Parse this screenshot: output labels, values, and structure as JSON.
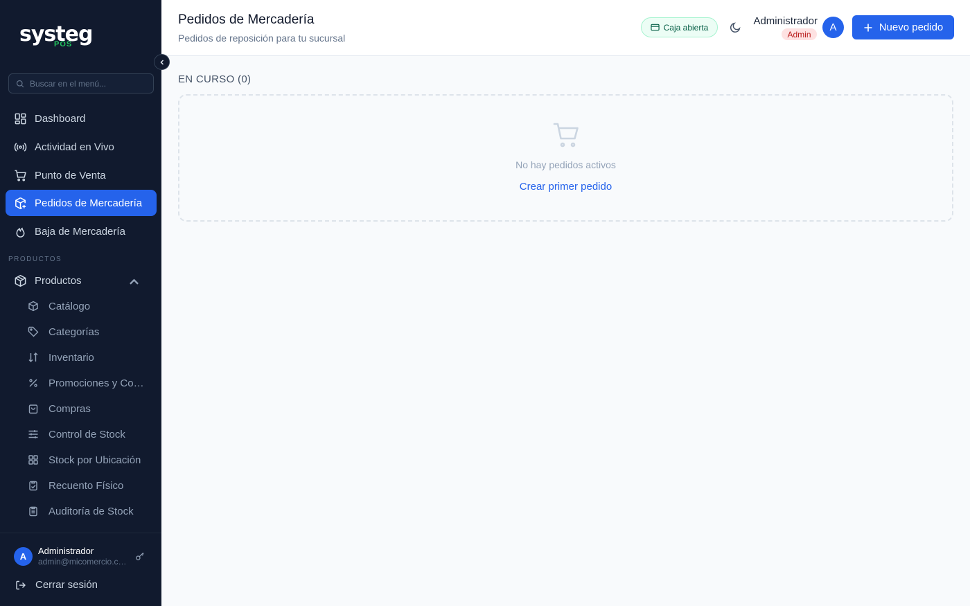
{
  "sidebar": {
    "logo_main": "systeg",
    "logo_sub": "POS",
    "search_placeholder": "Buscar en el menú...",
    "items": [
      {
        "label": "Dashboard"
      },
      {
        "label": "Actividad en Vivo"
      },
      {
        "label": "Punto de Venta"
      },
      {
        "label": "Pedidos de Mercadería"
      },
      {
        "label": "Baja de Mercadería"
      }
    ],
    "section_label": "PRODUCTOS",
    "group_label": "Productos",
    "sub_items": [
      {
        "label": "Catálogo"
      },
      {
        "label": "Categorías"
      },
      {
        "label": "Inventario"
      },
      {
        "label": "Promociones y Combos"
      },
      {
        "label": "Compras"
      },
      {
        "label": "Control de Stock"
      },
      {
        "label": "Stock por Ubicación"
      },
      {
        "label": "Recuento Físico"
      },
      {
        "label": "Auditoría de Stock"
      }
    ],
    "footer": {
      "avatar_initial": "A",
      "user_name": "Administrador",
      "user_email": "admin@micomercio.com",
      "logout_label": "Cerrar sesión"
    }
  },
  "header": {
    "title": "Pedidos de Mercadería",
    "subtitle": "Pedidos de reposición para tu sucursal",
    "caja_status": "Caja abierta",
    "user_name": "Administrador",
    "role": "Admin",
    "avatar_initial": "A",
    "new_button": "Nuevo pedido"
  },
  "main": {
    "section_title": "EN CURSO (0)",
    "empty_text": "No hay pedidos activos",
    "empty_link": "Crear primer pedido"
  },
  "colors": {
    "sidebar_bg": "#111a2e",
    "accent": "#2563eb",
    "caja_green": "#065f46",
    "admin_red": "#b91c1c"
  }
}
